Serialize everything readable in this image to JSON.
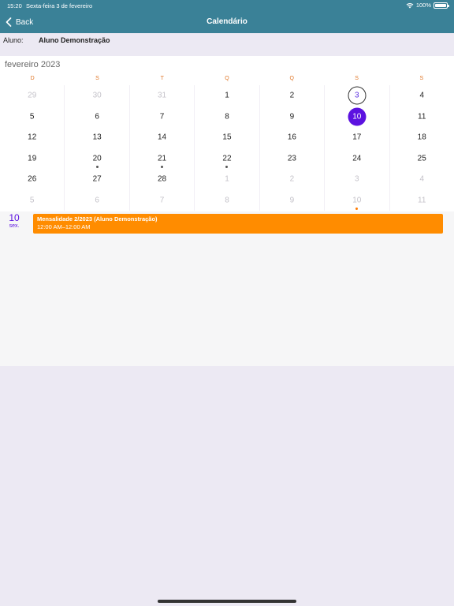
{
  "status_bar": {
    "time": "15:20",
    "date": "Sexta-feira 3 de fevereiro",
    "battery": "100%"
  },
  "nav": {
    "back_label": "Back",
    "title": "Calendário"
  },
  "student": {
    "label": "Aluno:",
    "name": "Aluno Demonstração"
  },
  "calendar": {
    "month": "fevereiro 2023",
    "weekdays": [
      "D",
      "S",
      "T",
      "Q",
      "Q",
      "S",
      "S"
    ],
    "weeks": [
      [
        {
          "n": "29",
          "m": true
        },
        {
          "n": "30",
          "m": true
        },
        {
          "n": "31",
          "m": true
        },
        {
          "n": "1"
        },
        {
          "n": "2"
        },
        {
          "n": "3",
          "today": true
        },
        {
          "n": "4"
        }
      ],
      [
        {
          "n": "5"
        },
        {
          "n": "6"
        },
        {
          "n": "7"
        },
        {
          "n": "8"
        },
        {
          "n": "9"
        },
        {
          "n": "10",
          "selected": true
        },
        {
          "n": "11"
        }
      ],
      [
        {
          "n": "12"
        },
        {
          "n": "13"
        },
        {
          "n": "14"
        },
        {
          "n": "15"
        },
        {
          "n": "16"
        },
        {
          "n": "17"
        },
        {
          "n": "18"
        }
      ],
      [
        {
          "n": "19"
        },
        {
          "n": "20",
          "dot": true
        },
        {
          "n": "21",
          "dot": true
        },
        {
          "n": "22",
          "dot": true
        },
        {
          "n": "23"
        },
        {
          "n": "24"
        },
        {
          "n": "25"
        }
      ],
      [
        {
          "n": "26"
        },
        {
          "n": "27"
        },
        {
          "n": "28"
        },
        {
          "n": "1",
          "m": true
        },
        {
          "n": "2",
          "m": true
        },
        {
          "n": "3",
          "m": true
        },
        {
          "n": "4",
          "m": true
        }
      ],
      [
        {
          "n": "5",
          "m": true
        },
        {
          "n": "6",
          "m": true
        },
        {
          "n": "7",
          "m": true
        },
        {
          "n": "8",
          "m": true
        },
        {
          "n": "9",
          "m": true
        },
        {
          "n": "10",
          "m": true,
          "dot": true,
          "dotColor": "orange"
        },
        {
          "n": "11",
          "m": true
        }
      ]
    ]
  },
  "selected_day": {
    "number": "10",
    "weekday": "sex."
  },
  "events": [
    {
      "title": "Mensalidade 2/2023 (Aluno Demonstração)",
      "time": "12:00 AM–12:00 AM"
    }
  ],
  "colors": {
    "header": "#3a8197",
    "accent": "#5c12e0",
    "event": "#ff8c00",
    "weekday": "#e0782a"
  },
  "icons": {
    "back": "chevron-left-icon",
    "wifi": "wifi-icon",
    "battery": "battery-icon"
  }
}
